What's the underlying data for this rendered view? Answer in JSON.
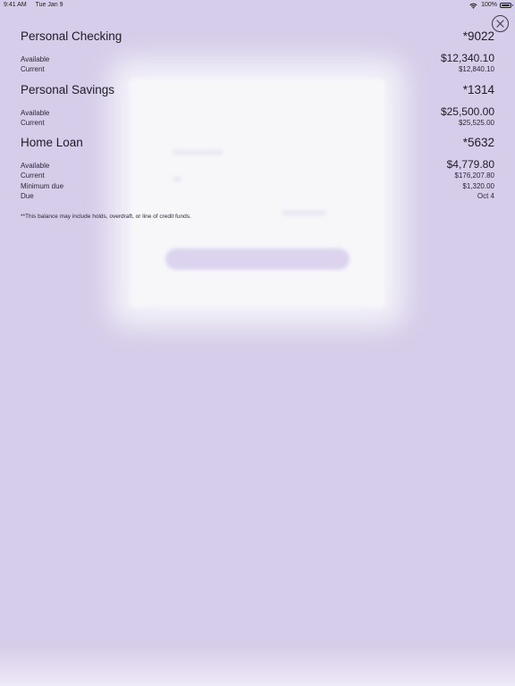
{
  "status_bar": {
    "time": "9:41 AM",
    "date": "Tue Jan 9",
    "battery_percent": "100%",
    "icons": [
      "wifi-icon",
      "battery-icon"
    ]
  },
  "close_button": {
    "icon": "close-icon"
  },
  "accounts": [
    {
      "name": "Personal Checking",
      "number": "*9022",
      "rows": [
        {
          "label": "Available",
          "value": "$12,340.10"
        },
        {
          "label": "Current",
          "value": "$12,840.10"
        }
      ]
    },
    {
      "name": "Personal Savings",
      "number": "*1314",
      "rows": [
        {
          "label": "Available",
          "value": "$25,500.00"
        },
        {
          "label": "Current",
          "value": "$25,525.00"
        }
      ]
    },
    {
      "name": "Home Loan",
      "number": "*5632",
      "rows": [
        {
          "label": "Available",
          "value": "$4,779.80"
        },
        {
          "label": "Current",
          "value": "$176,207.80"
        },
        {
          "label": "Minimum due",
          "value": "$1,320.00"
        },
        {
          "label": "Due",
          "value": "Oct 4"
        }
      ]
    }
  ],
  "disclaimer": "**This balance may include holds, overdraft, or line of credit funds.",
  "colors": {
    "overlay_background": "#d6cdea",
    "text": "#1e1b26",
    "card_background": "#f7f7fa"
  }
}
